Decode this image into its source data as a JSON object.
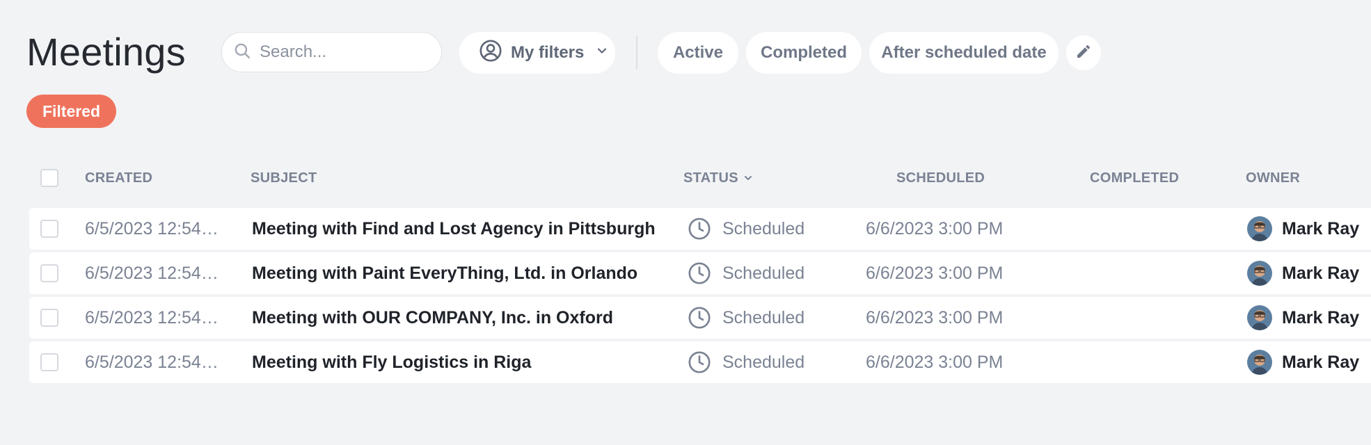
{
  "page": {
    "title": "Meetings"
  },
  "search": {
    "placeholder": "Search..."
  },
  "filters": {
    "my_filters_label": "My filters",
    "quick": [
      "Active",
      "Completed",
      "After scheduled date"
    ]
  },
  "badge": {
    "label": "Filtered"
  },
  "table": {
    "columns": {
      "created": "CREATED",
      "subject": "SUBJECT",
      "status": "STATUS",
      "scheduled": "SCHEDULED",
      "completed": "COMPLETED",
      "owner": "OWNER"
    },
    "rows": [
      {
        "created": "6/5/2023 12:54…",
        "subject": "Meeting with Find and Lost Agency in Pittsburgh",
        "status": "Scheduled",
        "scheduled": "6/6/2023 3:00 PM",
        "completed": "",
        "owner": "Mark Ray"
      },
      {
        "created": "6/5/2023 12:54…",
        "subject": "Meeting with Paint EveryThing, Ltd. in Orlando",
        "status": "Scheduled",
        "scheduled": "6/6/2023 3:00 PM",
        "completed": "",
        "owner": "Mark Ray"
      },
      {
        "created": "6/5/2023 12:54…",
        "subject": "Meeting with OUR COMPANY, Inc. in Oxford",
        "status": "Scheduled",
        "scheduled": "6/6/2023 3:00 PM",
        "completed": "",
        "owner": "Mark Ray"
      },
      {
        "created": "6/5/2023 12:54…",
        "subject": "Meeting with Fly Logistics in Riga",
        "status": "Scheduled",
        "scheduled": "6/6/2023 3:00 PM",
        "completed": "",
        "owner": "Mark Ray"
      }
    ]
  },
  "icons": {
    "search": "search-icon",
    "user_circle": "user-circle-icon",
    "chevron": "chevron-down-icon",
    "edit": "pencil-icon",
    "status": "clock-icon"
  },
  "colors": {
    "badge": "#ef735c",
    "background": "#f2f3f5",
    "muted_text": "#7a8293"
  }
}
